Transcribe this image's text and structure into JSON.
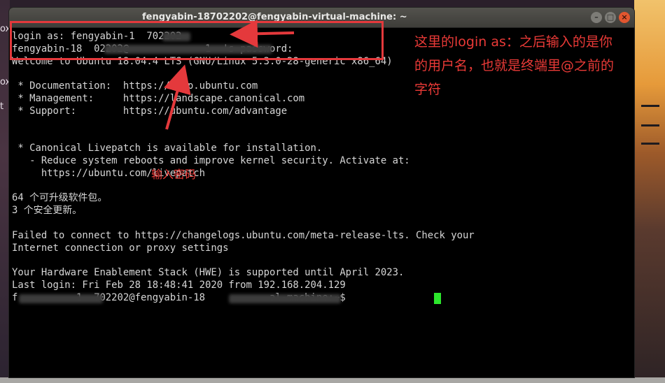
{
  "desktop": {
    "left_labels": [
      "ox",
      "ox",
      "t"
    ]
  },
  "window": {
    "title": "fengyabin-18702202@fengyabin-virtual-machine: ~",
    "buttons": [
      "–",
      "□",
      "×"
    ]
  },
  "terminal": {
    "lines": [
      "login as: fengyabin-1  702202",
      "fengyabin-18  02202@             1  's password:",
      "Welcome to Ubuntu 18.04.4 LTS (GNU/Linux 5.3.0-28-generic x86_64)",
      "",
      " * Documentation:  https://help.ubuntu.com",
      " * Management:     https://landscape.canonical.com",
      " * Support:        https://ubuntu.com/advantage",
      "",
      "",
      " * Canonical Livepatch is available for installation.",
      "   - Reduce system reboots and improve kernel security. Activate at:",
      "     https://ubuntu.com/livepatch",
      "",
      "64 个可升级软件包。",
      "3 个安全更新。",
      "",
      "Failed to connect to https://changelogs.ubuntu.com/meta-release-lts. Check your",
      "Internet connection or proxy settings",
      "",
      "Your Hardware Enablement Stack (HWE) is supported until April 2023.",
      "Last login: Fri Feb 28 18:48:41 2020 from 192.168.204.129",
      "f          1  702202@fengyabin-18           al-machine:~$ "
    ]
  },
  "annotations": {
    "login_note_lines": [
      "这里的login as：之后输入的是你",
      "的用户名，也就是终端里@之前的",
      "字符"
    ],
    "password_note": "输入密码"
  },
  "colors": {
    "terminal_bg": "#000000",
    "terminal_text": "#d6d6d6",
    "cursor": "#2ce62c",
    "annotation_red": "#e4393c",
    "close_button": "#e2562f"
  }
}
